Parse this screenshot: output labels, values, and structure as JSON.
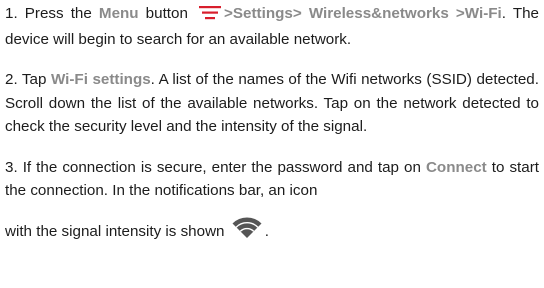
{
  "step1": {
    "prefix": "1. Press the ",
    "menu_label": "Menu",
    "button_word": " button ",
    "menu_icon": "menu-icon",
    "sep1": ">",
    "settings_label": "Settings",
    "sep2": "> ",
    "wireless_label": "Wireless&networks",
    "sep3": ">",
    "wifi_label": "Wi-Fi",
    "suffix": ". The device will begin to search for an available network."
  },
  "step2": {
    "prefix": "2. Tap ",
    "wifi_settings_label": "Wi-Fi settings",
    "suffix": ". A list of the names of the Wifi networks (SSID) detected. Scroll down the list of the available networks. Tap on the network detected to check the security level and the intensity of the signal."
  },
  "step3": {
    "prefix": "3. If the connection is secure, enter the password and tap on ",
    "connect_label": "Connect",
    "middle": " to start the connection. In the notifications bar, an icon",
    "last_line": "with the signal intensity is shown ",
    "wifi_icon": "wifi-signal-icon",
    "end": "."
  },
  "colors": {
    "text": "#1c1c1c",
    "keyword": "#8a8a8a",
    "menu_icon": "#d81e2c",
    "wifi_icon": "#555555"
  }
}
